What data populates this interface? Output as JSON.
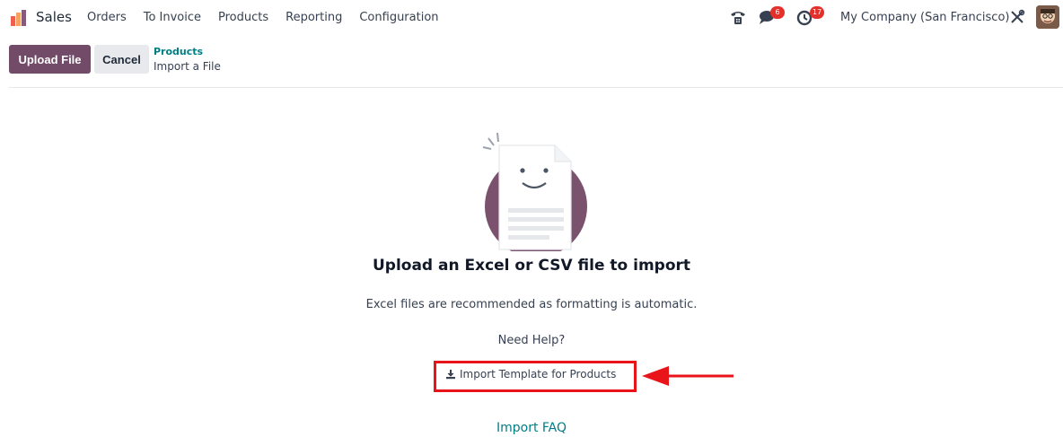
{
  "nav": {
    "brand": "Sales",
    "menu": [
      "Orders",
      "To Invoice",
      "Products",
      "Reporting",
      "Configuration"
    ],
    "messages_badge": "6",
    "activities_badge": "17",
    "company": "My Company (San Francisco)"
  },
  "control_panel": {
    "upload_label": "Upload File",
    "cancel_label": "Cancel",
    "breadcrumb_parent": "Products",
    "breadcrumb_current": "Import a File"
  },
  "main": {
    "title": "Upload an Excel or CSV file to import",
    "subtitle": "Excel files are recommended as formatting is automatic.",
    "help": "Need Help?",
    "template_link": "Import Template for Products",
    "faq_link": "Import FAQ"
  },
  "colors": {
    "primary": "#714b67",
    "link": "#017e84",
    "highlight": "#e8141a",
    "badge": "#e4302b"
  },
  "icons": [
    "app-logo-icon",
    "phone-icon",
    "chat-icon",
    "clock-icon",
    "tools-icon",
    "download-icon",
    "arrow-icon"
  ]
}
